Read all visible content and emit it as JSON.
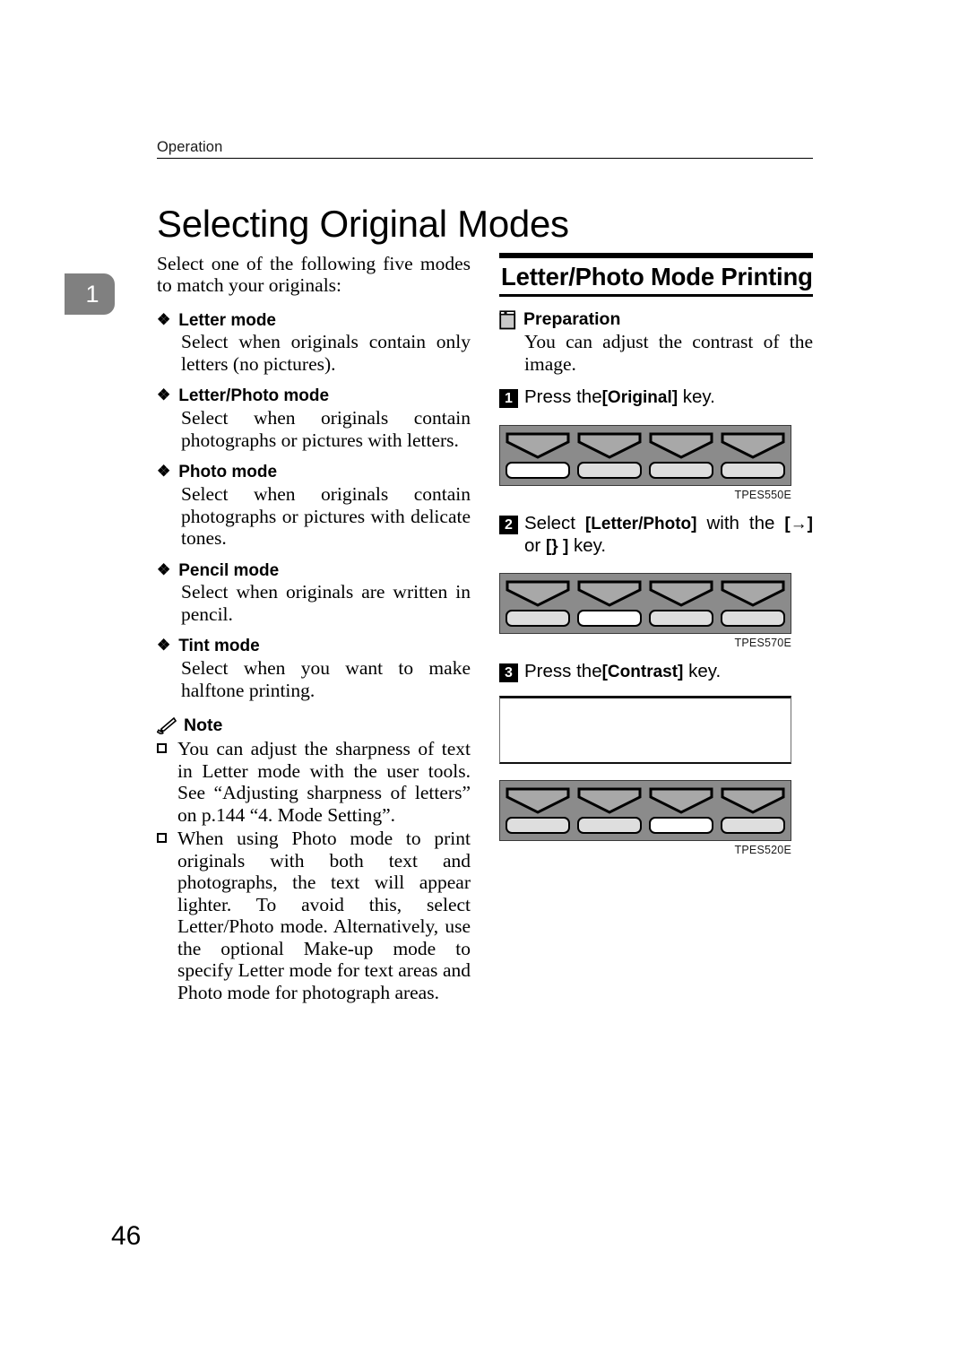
{
  "running_head": "Operation",
  "chapter_tab": "1",
  "page_title": "Selecting Original Modes",
  "folio": "46",
  "left_column": {
    "intro": "Select one of the following five modes to match your originals:",
    "modes": [
      {
        "heading": "Letter mode",
        "description": "Select when originals contain only letters (no pictures)."
      },
      {
        "heading": "Letter/Photo mode",
        "description": "Select when originals contain photographs or pictures with letters."
      },
      {
        "heading": "Photo mode",
        "description": "Select when originals contain photographs or pictures with delicate tones."
      },
      {
        "heading": "Pencil mode",
        "description": "Select when originals are written in pencil."
      },
      {
        "heading": "Tint mode",
        "description": "Select when you want to make halftone printing."
      }
    ],
    "note": {
      "heading": "Note",
      "items": [
        "You can adjust the sharpness of text in Letter mode with the user tools. See “Adjusting sharpness of letters” on p.144 “4. Mode Setting”.",
        "When using Photo mode to print originals with both text and photographs, the text will appear lighter. To avoid this, select Letter/Photo mode. Alternatively, use the optional Make-up mode to specify Letter mode for text areas and Photo mode for photograph areas."
      ]
    }
  },
  "right_column": {
    "section_title": "Letter/Photo Mode Printing",
    "preparation": {
      "heading": "Preparation",
      "body": "You can adjust the contrast of the image."
    },
    "steps": [
      {
        "number": "1",
        "prefix": "Press the",
        "key": "[Original]",
        "suffix": " key."
      },
      {
        "number": "2",
        "prefix": "Select ",
        "key": "[Letter/Photo]",
        "middle": " with the ",
        "key2": "[→]",
        "middle2": " or ",
        "key3": "[} ]",
        "suffix": " key."
      },
      {
        "number": "3",
        "prefix": "Press the",
        "key": "[Contrast]",
        "suffix": " key."
      }
    ],
    "figures": [
      {
        "caption": "TPES550E",
        "keys": [
          {
            "selected": true
          },
          {
            "selected": false
          },
          {
            "selected": false
          },
          {
            "selected": false
          }
        ]
      },
      {
        "caption": "TPES570E",
        "keys": [
          {
            "selected": false
          },
          {
            "selected": true
          },
          {
            "selected": false
          },
          {
            "selected": false
          }
        ]
      },
      {
        "caption": "TPES520E",
        "keys": [
          {
            "selected": false
          },
          {
            "selected": false
          },
          {
            "selected": true
          },
          {
            "selected": false
          }
        ]
      }
    ]
  },
  "colors": {
    "panel_background": "#8b8b8b",
    "chevron_fill": "#a8a8a8",
    "key_fill": "#dedede",
    "key_selected_fill": "#ffffff",
    "chapter_tab": "#808080"
  }
}
